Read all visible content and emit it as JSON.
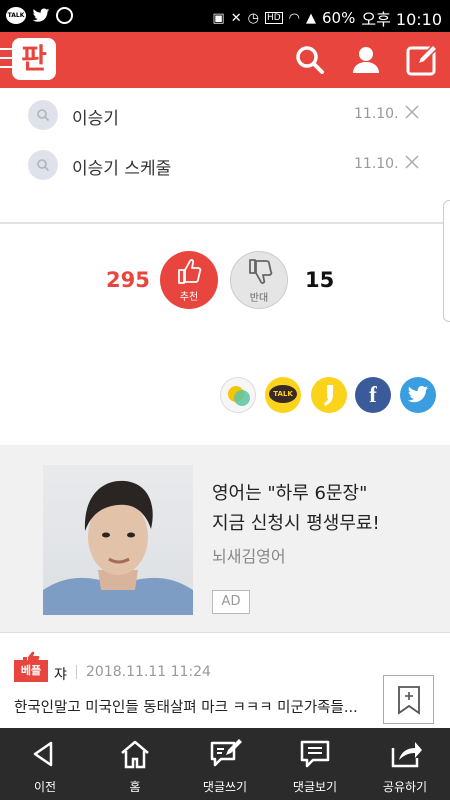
{
  "status_bar": {
    "left_apps": [
      "TALK"
    ],
    "battery": "60%",
    "time": "오후 10:10",
    "hd_badge": "HD"
  },
  "header": {
    "logo_text": "판",
    "icons": [
      "menu-icon",
      "search-icon",
      "user-icon",
      "write-icon"
    ]
  },
  "search_history": [
    {
      "term": "이승기",
      "date": "11.10."
    },
    {
      "term": "이승기 스케줄",
      "date": "11.10."
    }
  ],
  "votes": {
    "up_count": "295",
    "up_label": "추천",
    "down_label": "반대",
    "down_count": "15"
  },
  "share": {
    "icons": [
      "kakaostory-icon",
      "kakaotalk-icon",
      "kakao-channel-icon",
      "facebook-icon",
      "twitter-icon"
    ],
    "kakaotalk_text": "TALK",
    "facebook_text": "f"
  },
  "ad": {
    "line1": "영어는 \"하루 6문장\"",
    "line2": "지금 신청시 평생무료!",
    "brand": "뇌새김영어",
    "badge": "AD"
  },
  "best_comment": {
    "tag": "베플",
    "author": "쟈",
    "time": "2018.11.11 11:24",
    "text": "한국인말고 미국인들 동태살펴 마크 ㅋㅋㅋ 미군가족들..."
  },
  "bottom_nav": [
    {
      "label": "이전",
      "icon": "back-icon"
    },
    {
      "label": "홈",
      "icon": "home-icon"
    },
    {
      "label": "댓글쓰기",
      "icon": "write-comment-icon"
    },
    {
      "label": "댓글보기",
      "icon": "view-comments-icon"
    },
    {
      "label": "공유하기",
      "icon": "share-icon"
    }
  ],
  "colors": {
    "brand_red": "#e8453f",
    "kakao_yellow": "#fbd31b",
    "facebook_blue": "#3b5a9a",
    "twitter_blue": "#3b9ee0",
    "nav_bg": "#2b2b2b"
  }
}
